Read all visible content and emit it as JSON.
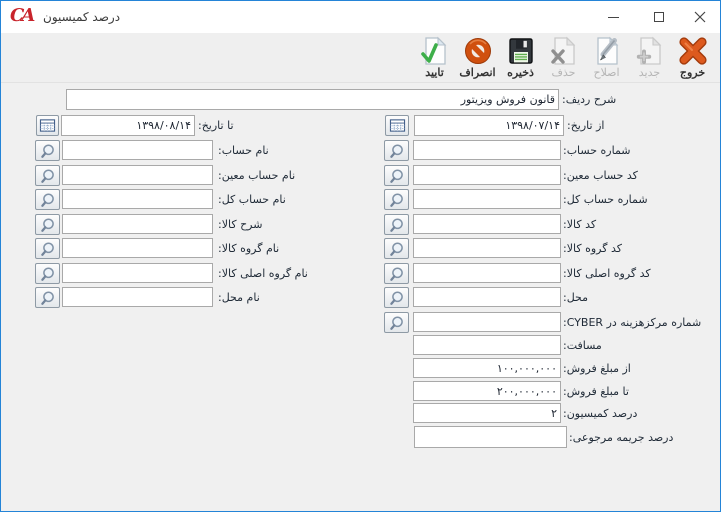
{
  "window": {
    "title": "درصد کمیسیون",
    "logo_text": "CA"
  },
  "toolbar": {
    "buttons": [
      {
        "label": "تایید",
        "icon": "confirm-check-icon",
        "enabled": true
      },
      {
        "label": "انصراف",
        "icon": "cancel-no-icon",
        "enabled": true
      },
      {
        "label": "ذخیره",
        "icon": "save-floppy-icon",
        "enabled": true
      },
      {
        "label": "حذف",
        "icon": "delete-page-icon",
        "enabled": false
      },
      {
        "label": "اصلاح",
        "icon": "edit-pencil-icon",
        "enabled": false
      },
      {
        "label": "جدید",
        "icon": "new-page-icon",
        "enabled": false
      },
      {
        "label": "خروج",
        "icon": "exit-x-icon",
        "enabled": true
      }
    ]
  },
  "form": {
    "description": {
      "label": "شرح ردیف:",
      "value": "قانون فروش ویزیتور"
    },
    "from_date": {
      "label": "از تاریخ:",
      "value": "۱۳۹۸/۰۷/۱۴"
    },
    "to_date": {
      "label": "تا تاریخ:",
      "value": "۱۳۹۸/۰۸/۱۴"
    },
    "right_fields": [
      {
        "label": "شماره حساب:",
        "value": ""
      },
      {
        "label": "کد حساب معین:",
        "value": ""
      },
      {
        "label": "شماره حساب کل:",
        "value": ""
      },
      {
        "label": "کد کالا:",
        "value": ""
      },
      {
        "label": "کد گروه کالا:",
        "value": ""
      },
      {
        "label": "کد گروه اصلی کالا:",
        "value": ""
      },
      {
        "label": "محل:",
        "value": ""
      },
      {
        "label": "شماره مرکزهزینه در CYBER:",
        "value": ""
      }
    ],
    "right_plain_fields": [
      {
        "label": "مسافت:",
        "value": ""
      },
      {
        "label": "از مبلغ فروش:",
        "value": "۱۰۰,۰۰۰,۰۰۰"
      },
      {
        "label": "تا مبلغ فروش:",
        "value": "۲۰۰,۰۰۰,۰۰۰"
      },
      {
        "label": "درصد کمیسیون:",
        "value": "۲"
      },
      {
        "label": "درصد جریمه مرجوعی:",
        "value": ""
      }
    ],
    "left_fields": [
      {
        "label": "نام حساب:",
        "value": ""
      },
      {
        "label": "نام حساب معین:",
        "value": ""
      },
      {
        "label": "نام حساب کل:",
        "value": ""
      },
      {
        "label": "شرح کالا:",
        "value": ""
      },
      {
        "label": "نام گروه کالا:",
        "value": ""
      },
      {
        "label": "نام گروه اصلی کالا:",
        "value": ""
      },
      {
        "label": "نام محل:",
        "value": ""
      }
    ]
  },
  "colors": {
    "window_border": "#2484d7",
    "titlebar_bg": "#ffffff",
    "toolbar_bg": "#efefef",
    "client_bg": "#f0f0f0",
    "logo_red": "#c8242b",
    "exit_orange": "#dd5a1e",
    "confirm_green": "#3dae49"
  }
}
